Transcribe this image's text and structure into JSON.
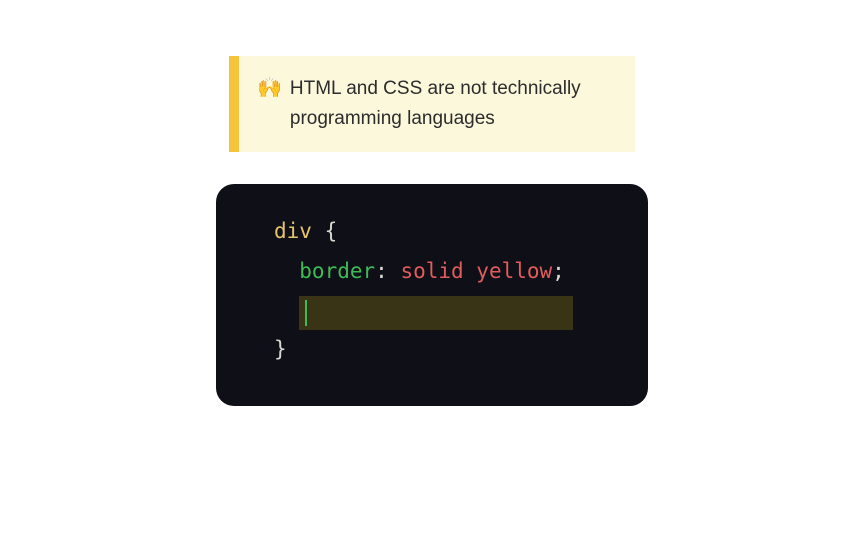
{
  "callout": {
    "emoji": "🙌",
    "text": "HTML and CSS are not technically programming languages",
    "accent_color": "#f6c43a",
    "background_color": "#fcf8dc"
  },
  "code": {
    "selector": "div",
    "open_brace": "{",
    "property": "border",
    "colon": ":",
    "value": "solid yellow",
    "semicolon": ";",
    "close_brace": "}"
  }
}
